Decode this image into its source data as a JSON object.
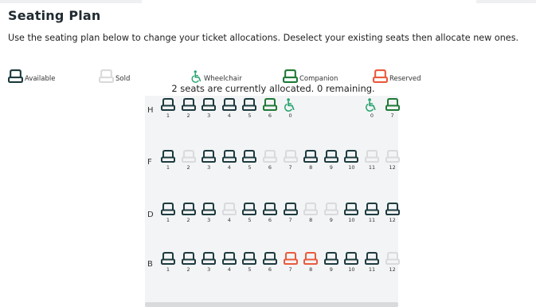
{
  "page": {
    "title": "Seating Plan",
    "description": "Use the seating plan below to change your ticket allocations. Deselect your existing seats then allocate new ones.",
    "status": "2 seats are currently allocated. 0 remaining."
  },
  "legend": [
    {
      "label": "Available",
      "type": "available"
    },
    {
      "label": "Sold",
      "type": "sold"
    },
    {
      "label": "Wheelchair",
      "type": "wheelchair"
    },
    {
      "label": "Companion",
      "type": "companion"
    },
    {
      "label": "Reserved",
      "type": "reserved"
    }
  ],
  "colors": {
    "available": "#1d3b3f",
    "sold": "#d8dadc",
    "wheelchair": "#27a36e",
    "companion": "#1f7a37",
    "reserved": "#ea5a3c"
  },
  "rows": [
    {
      "letter": "H",
      "seats": [
        {
          "num": "1",
          "type": "available"
        },
        {
          "num": "2",
          "type": "available"
        },
        {
          "num": "3",
          "type": "available"
        },
        {
          "num": "4",
          "type": "available"
        },
        {
          "num": "5",
          "type": "available"
        },
        {
          "num": "6",
          "type": "companion"
        },
        {
          "num": "0",
          "type": "wheelchair"
        },
        {
          "num": "",
          "type": "gap"
        },
        {
          "num": "",
          "type": "gap"
        },
        {
          "num": "",
          "type": "gap"
        },
        {
          "num": "0",
          "type": "wheelchair"
        },
        {
          "num": "7",
          "type": "companion"
        }
      ]
    },
    {
      "letter": "F",
      "seats": [
        {
          "num": "1",
          "type": "available"
        },
        {
          "num": "2",
          "type": "sold"
        },
        {
          "num": "3",
          "type": "available"
        },
        {
          "num": "4",
          "type": "available"
        },
        {
          "num": "5",
          "type": "available"
        },
        {
          "num": "6",
          "type": "sold"
        },
        {
          "num": "7",
          "type": "sold"
        },
        {
          "num": "8",
          "type": "available"
        },
        {
          "num": "9",
          "type": "available"
        },
        {
          "num": "10",
          "type": "available"
        },
        {
          "num": "11",
          "type": "sold"
        },
        {
          "num": "12",
          "type": "sold"
        }
      ]
    },
    {
      "letter": "D",
      "seats": [
        {
          "num": "1",
          "type": "available"
        },
        {
          "num": "2",
          "type": "available"
        },
        {
          "num": "3",
          "type": "available"
        },
        {
          "num": "4",
          "type": "sold"
        },
        {
          "num": "5",
          "type": "available"
        },
        {
          "num": "6",
          "type": "available"
        },
        {
          "num": "7",
          "type": "available"
        },
        {
          "num": "8",
          "type": "sold"
        },
        {
          "num": "9",
          "type": "sold"
        },
        {
          "num": "10",
          "type": "available"
        },
        {
          "num": "11",
          "type": "available"
        },
        {
          "num": "12",
          "type": "available"
        }
      ]
    },
    {
      "letter": "B",
      "seats": [
        {
          "num": "1",
          "type": "available"
        },
        {
          "num": "2",
          "type": "available"
        },
        {
          "num": "3",
          "type": "available"
        },
        {
          "num": "4",
          "type": "available"
        },
        {
          "num": "5",
          "type": "available"
        },
        {
          "num": "6",
          "type": "available"
        },
        {
          "num": "7",
          "type": "reserved"
        },
        {
          "num": "8",
          "type": "reserved"
        },
        {
          "num": "9",
          "type": "available"
        },
        {
          "num": "10",
          "type": "available"
        },
        {
          "num": "11",
          "type": "available"
        },
        {
          "num": "12",
          "type": "sold"
        }
      ]
    }
  ]
}
